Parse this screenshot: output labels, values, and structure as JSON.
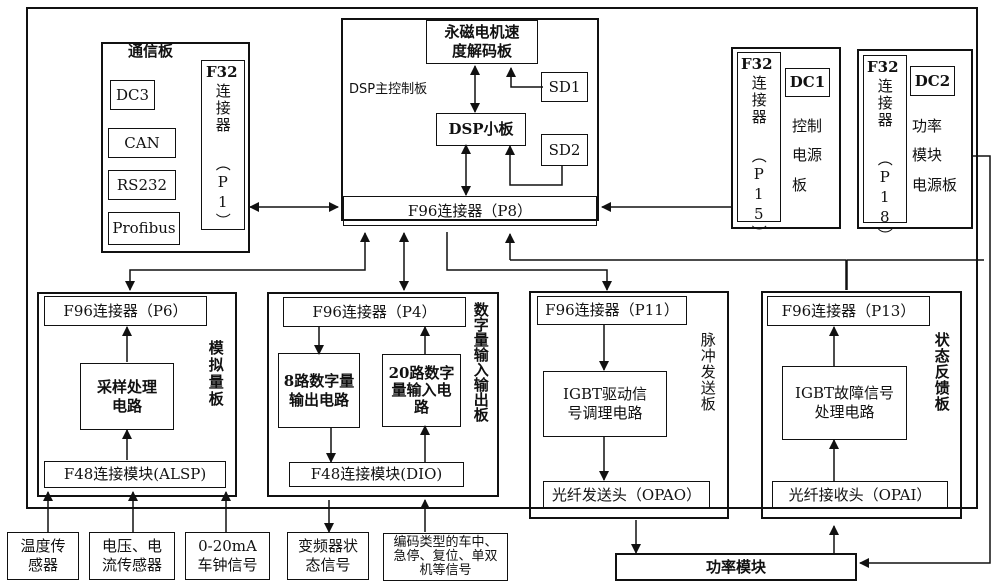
{
  "comm_board": {
    "title": "通信板",
    "dc": "DC3",
    "can": "CAN",
    "rs232": "RS232",
    "profibus": "Profibus",
    "connector_top": "F32",
    "connector_mid": "连接器",
    "connector_port": "（P1）"
  },
  "dsp_board": {
    "title": "DSP主控制板",
    "decoder": "永磁电机速度解码板",
    "decoder_line1": "永磁电机速",
    "decoder_line2": "度解码板",
    "sd1": "SD1",
    "sd2": "SD2",
    "dsp_small": "DSP小板",
    "connector": "F96连接器（P8）"
  },
  "control_power_board": {
    "connector_top": "F32",
    "connector_mid": "连接器",
    "connector_port": "（P15）",
    "dc": "DC1",
    "label": "控制电源板",
    "label_line1": "控制",
    "label_line2": "电源",
    "label_line3": "板"
  },
  "power_module_power_board": {
    "connector_top": "F32",
    "connector_mid": "连接器",
    "connector_port": "（P18）",
    "dc": "DC2",
    "label_line1": "功率",
    "label_line2": "模块",
    "label_line3": "电源板"
  },
  "analog_board": {
    "title": "模拟量板",
    "connector": "F96连接器（P6）",
    "circuit_line1": "采样处理",
    "circuit_line2": "电路",
    "module": "F48连接模块(ALSP)"
  },
  "digital_io_board": {
    "title": "数字量输入输出板",
    "connector": "F96连接器（P4）",
    "out_line1": "8路数字量",
    "out_line2": "输出电路",
    "in_line1": "20路数字",
    "in_line2": "量输入电",
    "in_line3": "路",
    "module": "F48连接模块(DIO)"
  },
  "pulse_board": {
    "title": "脉冲发送板",
    "connector": "F96连接器（P11）",
    "circuit_line1": "IGBT驱动信",
    "circuit_line2": "号调理电路",
    "optic": "光纤发送头（OPAO）"
  },
  "feedback_board": {
    "title": "状态反馈板",
    "connector": "F96连接器（P13）",
    "circuit_line1": "IGBT故障信号",
    "circuit_line2": "处理电路",
    "optic": "光纤接收头（OPAI）"
  },
  "inputs": {
    "temp_line1": "温度传",
    "temp_line2": "感器",
    "vi_line1": "电压、电",
    "vi_line2": "流传感器",
    "ma_line1": "0-20mA",
    "ma_line2": "车钟信号",
    "vfd_line1": "变频器状",
    "vfd_line2": "态信号",
    "enc_line1": "编码类型的车中、",
    "enc_line2": "急停、复位、单双",
    "enc_line3": "机等信号"
  },
  "power_module": {
    "label": "功率模块"
  }
}
